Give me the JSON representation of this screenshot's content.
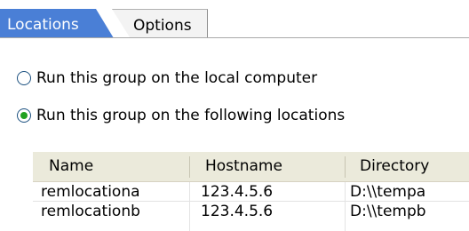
{
  "tabs": [
    {
      "label": "Locations"
    },
    {
      "label": "Options"
    }
  ],
  "options": {
    "local": {
      "label": "Run this group on the local computer",
      "selected": false
    },
    "following": {
      "label": "Run this group on the following locations",
      "selected": true
    }
  },
  "table": {
    "headers": [
      "Name",
      "Hostname",
      "Directory"
    ],
    "rows": [
      [
        "remlocationa",
        "123.4.5.6",
        "D:\\\\tempa"
      ],
      [
        "remlocationb",
        "123.4.5.6",
        "D:\\\\tempb"
      ]
    ]
  },
  "colors": {
    "active_tab": "#4a7fd6",
    "radio_dot": "#21a121",
    "header_bg": "#ebeadb"
  }
}
